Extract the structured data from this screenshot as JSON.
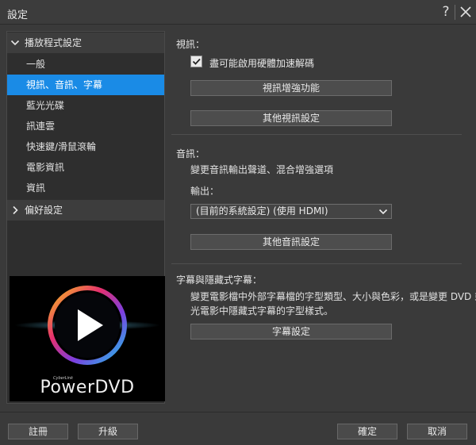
{
  "window": {
    "title": "設定",
    "help": "?"
  },
  "sidebar": {
    "groups": [
      {
        "label": "播放程式設定",
        "expanded": true
      },
      {
        "label": "偏好設定",
        "expanded": false
      }
    ],
    "items": [
      {
        "label": "一般"
      },
      {
        "label": "視訊、音訊、字幕",
        "active": true
      },
      {
        "label": "藍光光碟"
      },
      {
        "label": "訊連雲"
      },
      {
        "label": "快速鍵/滑鼠滾輪"
      },
      {
        "label": "電影資訊"
      },
      {
        "label": "資訊"
      }
    ],
    "logo": {
      "brand": "CyberLink",
      "name": "PowerDVD"
    }
  },
  "video": {
    "title": "視訊：",
    "hw_decode_label": "盡可能啟用硬體加速解碼",
    "hw_decode_checked": true,
    "enhance_button": "視訊增強功能",
    "other_button": "其他視訊設定"
  },
  "audio": {
    "title": "音訊：",
    "description": "變更音訊輸出聲道、混合增強選項",
    "output_label": "輸出：",
    "output_value": "(目前的系統設定) (使用 HDMI)",
    "other_button": "其他音訊設定"
  },
  "subtitles": {
    "title": "字幕與隱藏式字幕：",
    "description_line1": "變更電影檔中外部字幕檔的字型類型、大小與色彩，或是變更 DVD 或藍",
    "description_line2": "光電影中隱藏式字幕的字型樣式。",
    "button": "字幕設定"
  },
  "footer": {
    "register": "註冊",
    "upgrade": "升級",
    "ok": "確定",
    "cancel": "取消"
  }
}
